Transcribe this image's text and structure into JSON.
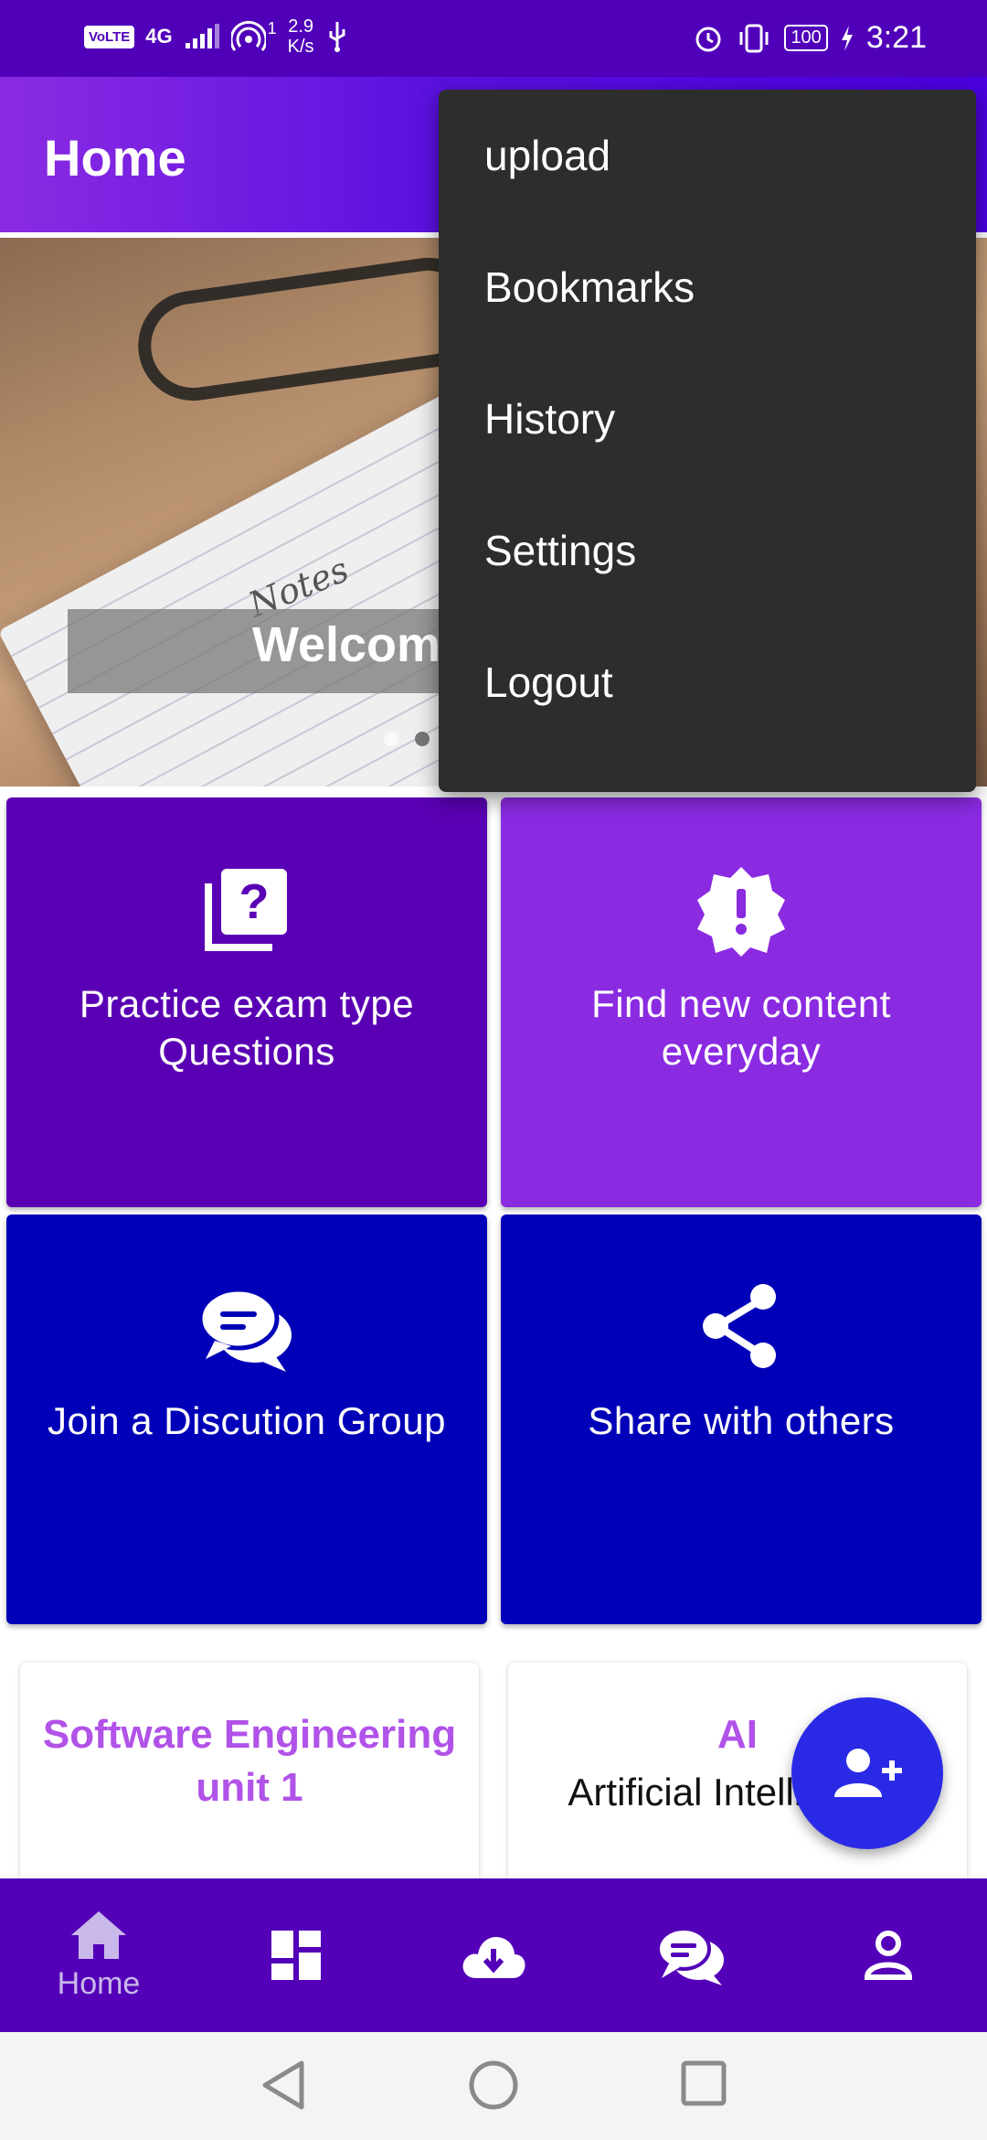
{
  "status_bar": {
    "volte": "VoLTE",
    "network": "4G",
    "hotspot_count": "1",
    "speed_value": "2.9",
    "speed_unit": "K/s",
    "battery": "100",
    "time": "3:21"
  },
  "app_bar": {
    "title": "Home"
  },
  "banner": {
    "welcome_text": "Welcom",
    "notes_word": "Notes"
  },
  "menu": {
    "items": [
      {
        "label": "upload"
      },
      {
        "label": "Bookmarks"
      },
      {
        "label": "History"
      },
      {
        "label": "Settings"
      },
      {
        "label": "Logout"
      }
    ]
  },
  "tiles": [
    {
      "label": "Practice exam type Questions",
      "icon": "quiz-icon",
      "color": "#5a00b4"
    },
    {
      "label": "Find new content everyday",
      "icon": "new-releases-icon",
      "color": "#8a2be2"
    },
    {
      "label": "Join a Discution Group",
      "icon": "forum-icon",
      "color": "#0000b8"
    },
    {
      "label": "Share with others",
      "icon": "share-icon",
      "color": "#0000b8"
    }
  ],
  "cards": [
    {
      "title": "Software Engineering unit 1",
      "subtitle": ""
    },
    {
      "title": "AI",
      "subtitle": "Artificial Intelligence"
    }
  ],
  "fab": {
    "icon": "add-user-icon"
  },
  "bottom_nav": {
    "items": [
      {
        "label": "Home",
        "icon": "home-icon"
      },
      {
        "label": "",
        "icon": "dashboard-icon"
      },
      {
        "label": "",
        "icon": "cloud-download-icon"
      },
      {
        "label": "",
        "icon": "chat-icon"
      },
      {
        "label": "",
        "icon": "person-icon"
      }
    ]
  },
  "colors": {
    "status_bar": "#5000b9",
    "bottom_nav": "#5300b8",
    "fab": "#2a2ae6",
    "card_title": "#b152e8",
    "menu_bg": "#2d2d2d"
  }
}
